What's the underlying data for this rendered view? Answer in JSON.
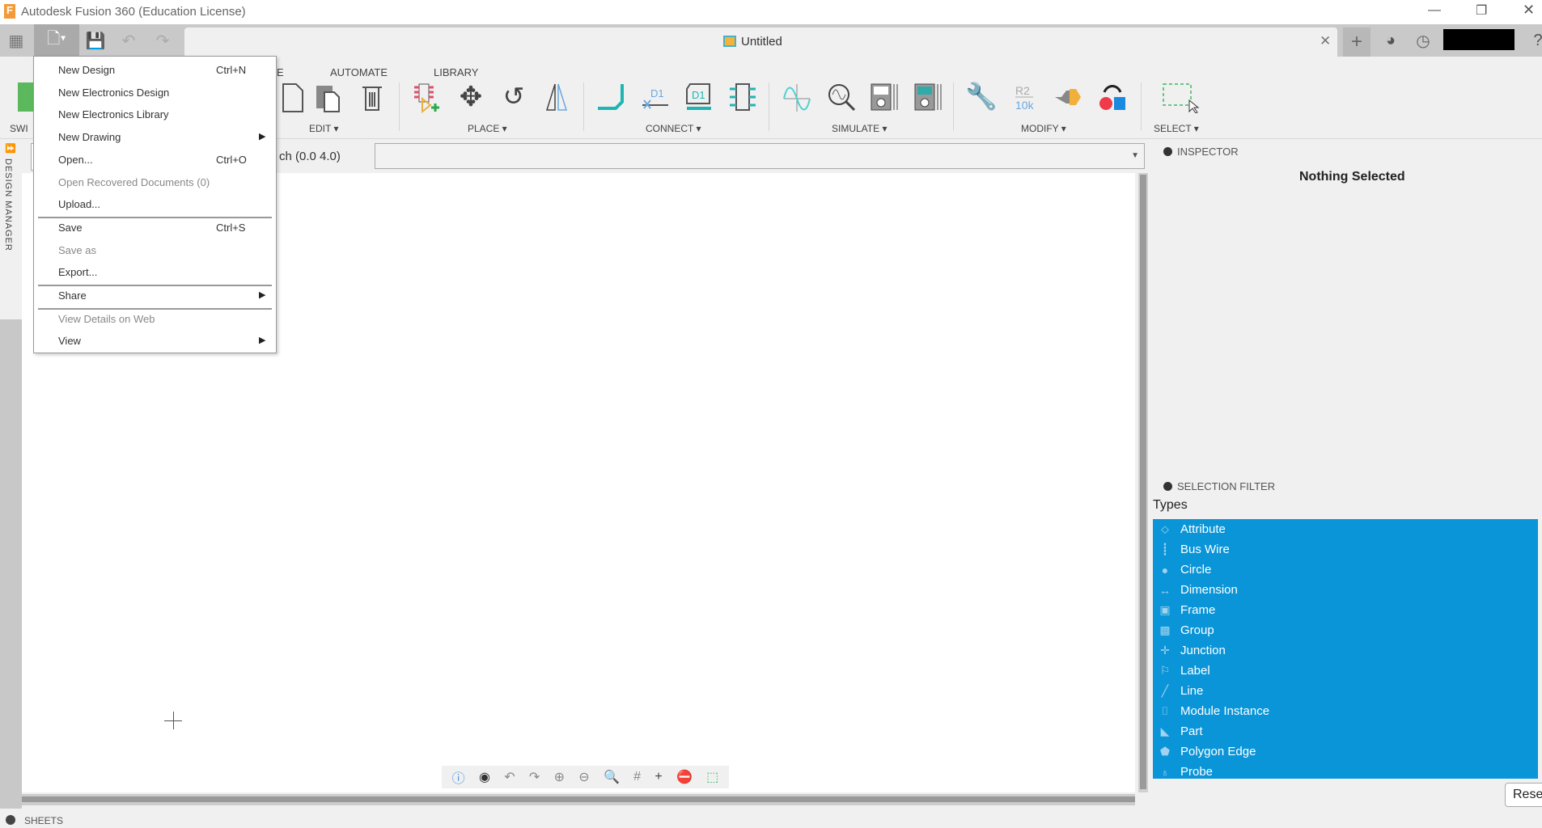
{
  "window": {
    "title": "Autodesk Fusion 360 (Education License)",
    "controls": [
      "minimize",
      "restore",
      "close"
    ]
  },
  "tab": {
    "title": "Untitled"
  },
  "ribbon": {
    "tabs": [
      "E",
      "AUTOMATE",
      "LIBRARY"
    ],
    "switch_label": "SWI",
    "groups": [
      "EDIT ▾",
      "PLACE ▾",
      "CONNECT ▾",
      "SIMULATE ▾",
      "MODIFY ▾",
      "SELECT ▾"
    ]
  },
  "address": {
    "text": "ch (0.0 4.0)"
  },
  "design_manager": {
    "label": "DESIGN MANAGER"
  },
  "file_menu": {
    "items": [
      {
        "label": "New Design",
        "shortcut": "Ctrl+N"
      },
      {
        "label": "New Electronics Design"
      },
      {
        "label": "New Electronics Library"
      },
      {
        "label": "New Drawing",
        "submenu": true
      },
      {
        "label": "Open...",
        "shortcut": "Ctrl+O"
      },
      {
        "label": "Open Recovered Documents (0)",
        "disabled": true
      },
      {
        "label": "Upload..."
      },
      {
        "label": "Save",
        "shortcut": "Ctrl+S"
      },
      {
        "label": "Save as",
        "disabled": true
      },
      {
        "label": "Export..."
      },
      {
        "label": "Share",
        "submenu": true
      },
      {
        "label": "View Details on Web",
        "disabled": true
      },
      {
        "label": "View",
        "submenu": true
      }
    ]
  },
  "inspector": {
    "title": "INSPECTOR",
    "status": "Nothing Selected"
  },
  "selection_filter": {
    "title": "SELECTION FILTER",
    "types_label": "Types",
    "reset_label": "Rese",
    "types": [
      {
        "label": "Attribute",
        "icon": "tag-icon"
      },
      {
        "label": "Bus Wire",
        "icon": "bus-wire-icon"
      },
      {
        "label": "Circle",
        "icon": "circle-icon"
      },
      {
        "label": "Dimension",
        "icon": "dimension-icon"
      },
      {
        "label": "Frame",
        "icon": "frame-icon"
      },
      {
        "label": "Group",
        "icon": "group-icon"
      },
      {
        "label": "Junction",
        "icon": "junction-icon"
      },
      {
        "label": "Label",
        "icon": "label-icon"
      },
      {
        "label": "Line",
        "icon": "line-icon"
      },
      {
        "label": "Module Instance",
        "icon": "module-icon"
      },
      {
        "label": "Part",
        "icon": "part-icon"
      },
      {
        "label": "Polygon Edge",
        "icon": "polygon-icon"
      },
      {
        "label": "Probe",
        "icon": "probe-icon"
      }
    ]
  },
  "sheets": {
    "label": "SHEETS"
  },
  "colors": {
    "selection": "#0a95d8",
    "accent_teal": "#1fb5b5"
  }
}
